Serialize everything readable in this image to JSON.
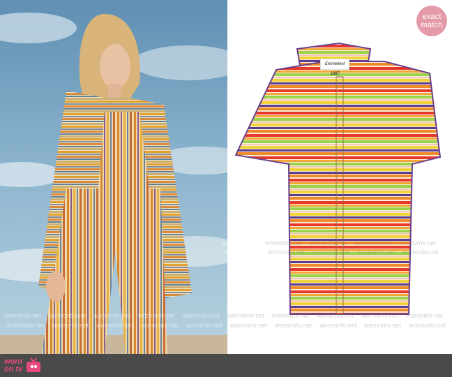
{
  "badge": {
    "line1": "exact",
    "line2": "match"
  },
  "shirt_label": "Emmelinel 1887",
  "logo": {
    "line1": "worn",
    "line2": "on tv",
    "icon": "tv-icon"
  },
  "watermark": "wornontv.net",
  "colors": {
    "sky": "#6f9fc0",
    "badge": "#e59aaa",
    "bar": "#4a4a4a",
    "logo": "#e84a7f"
  }
}
